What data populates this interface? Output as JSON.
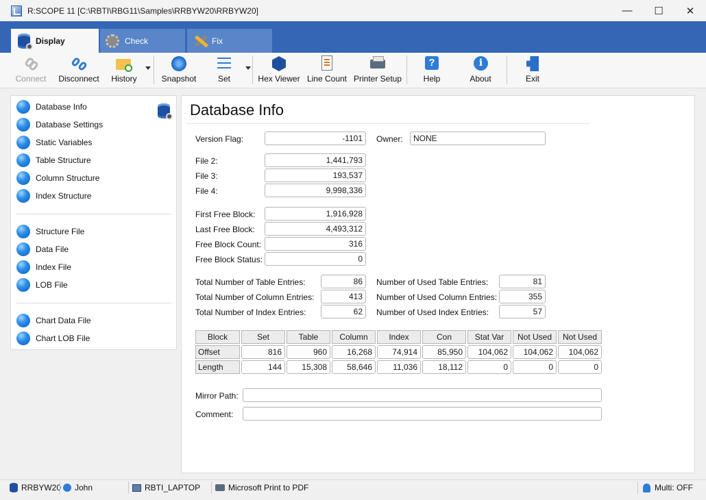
{
  "window": {
    "title": "R:SCOPE 11 [C:\\RBTI\\RBG11\\Samples\\RRBYW20\\RRBYW20]",
    "minimize": "—",
    "maximize": "☐",
    "close": "✕"
  },
  "tabs": [
    {
      "label": "Display",
      "icon": "database-gear-icon",
      "active": true
    },
    {
      "label": "Check",
      "icon": "gear-icon",
      "active": false
    },
    {
      "label": "Fix",
      "icon": "tools-icon",
      "active": false
    }
  ],
  "toolbar": {
    "connect": "Connect",
    "disconnect": "Disconnect",
    "history": "History",
    "snapshot": "Snapshot",
    "set": "Set",
    "hex_viewer": "Hex Viewer",
    "line_count": "Line Count",
    "printer_setup": "Printer Setup",
    "help": "Help",
    "about": "About",
    "exit": "Exit"
  },
  "sidebar": {
    "items": [
      "Database Info",
      "Database Settings",
      "Static Variables",
      "Table Structure",
      "Column Structure",
      "Index Structure",
      "Structure File",
      "Data File",
      "Index File",
      "LOB File",
      "Chart Data File",
      "Chart LOB File"
    ]
  },
  "main": {
    "title": "Database Info",
    "version_flag_label": "Version Flag:",
    "version_flag": "-1101",
    "owner_label": "Owner:",
    "owner": "NONE",
    "file2_label": "File 2:",
    "file2": "1,441,793",
    "file3_label": "File 3:",
    "file3": "193,537",
    "file4_label": "File 4:",
    "file4": "9,998,336",
    "first_free_label": "First Free Block:",
    "first_free": "1,916,928",
    "last_free_label": "Last Free Block:",
    "last_free": "4,493,312",
    "free_count_label": "Free Block Count:",
    "free_count": "316",
    "free_status_label": "Free Block Status:",
    "free_status": "0",
    "total_table_label": "Total Number of Table Entries:",
    "total_table": "86",
    "total_column_label": "Total Number of Column Entries:",
    "total_column": "413",
    "total_index_label": "Total Number of Index Entries:",
    "total_index": "62",
    "used_table_label": "Number of Used Table Entries:",
    "used_table": "81",
    "used_column_label": "Number of Used Column Entries:",
    "used_column": "355",
    "used_index_label": "Number of Used Index Entries:",
    "used_index": "57",
    "mirror_label": "Mirror Path:",
    "mirror": "",
    "comment_label": "Comment:",
    "comment": ""
  },
  "block_table": {
    "headers": [
      "Block",
      "Set",
      "Table",
      "Column",
      "Index",
      "Con",
      "Stat Var",
      "Not Used",
      "Not Used"
    ],
    "rows": [
      {
        "label": "Offset",
        "values": [
          "816",
          "960",
          "16,268",
          "74,914",
          "85,950",
          "104,062",
          "104,062",
          "104,062"
        ]
      },
      {
        "label": "Length",
        "values": [
          "144",
          "15,308",
          "58,646",
          "11,036",
          "18,112",
          "0",
          "0",
          "0"
        ]
      }
    ]
  },
  "statusbar": {
    "database": "RRBYW20",
    "user": "John",
    "computer": "RBTI_LAPTOP",
    "printer": "Microsoft Print to PDF",
    "multi": "Multi: OFF"
  }
}
